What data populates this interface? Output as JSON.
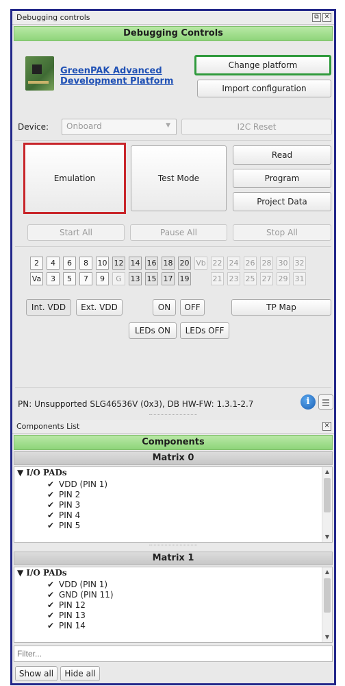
{
  "debug_panel": {
    "dock_title": "Debugging controls",
    "header": "Debugging Controls",
    "platform_link": "GreenPAK Advanced Development Platform",
    "change_platform": "Change platform",
    "import_configuration": "Import configuration",
    "device_label": "Device:",
    "device_value": "Onboard",
    "i2c_reset": "I2C Reset",
    "emulation": "Emulation",
    "test_mode": "Test Mode",
    "read": "Read",
    "program": "Program",
    "project_data": "Project Data",
    "start_all": "Start All",
    "pause_all": "Pause All",
    "stop_all": "Stop All",
    "pins_row1": [
      "2",
      "4",
      "6",
      "8",
      "10",
      "12",
      "14",
      "16",
      "18",
      "20",
      "Vb",
      "22",
      "24",
      "26",
      "28",
      "30",
      "32"
    ],
    "pins_row2": [
      "Va",
      "3",
      "5",
      "7",
      "9",
      "G",
      "13",
      "15",
      "17",
      "19",
      "",
      "21",
      "23",
      "25",
      "27",
      "29",
      "31"
    ],
    "int_vdd": "Int. VDD",
    "ext_vdd": "Ext. VDD",
    "on": "ON",
    "off": "OFF",
    "tp_map": "TP Map",
    "leds_on": "LEDs ON",
    "leds_off": "LEDs OFF",
    "status": "PN: Unsupported SLG46536V (0x3), DB HW-FW: 1.3.1-2.7"
  },
  "components_panel": {
    "dock_title": "Components List",
    "header": "Components",
    "matrix0": {
      "title": "Matrix 0",
      "root": "I/O PADs",
      "items": [
        "VDD (PIN 1)",
        "PIN 2",
        "PIN 3",
        "PIN 4",
        "PIN 5"
      ]
    },
    "matrix1": {
      "title": "Matrix 1",
      "root": "I/O PADs",
      "items": [
        "VDD (PIN 1)",
        "GND (PIN 11)",
        "PIN 12",
        "PIN 13",
        "PIN 14"
      ]
    },
    "filter_placeholder": "Filter...",
    "show_all": "Show all",
    "hide_all": "Hide all"
  },
  "highlight_colors": {
    "green": "#2f9a3c",
    "red": "#c8262b",
    "frame": "#23288a"
  }
}
